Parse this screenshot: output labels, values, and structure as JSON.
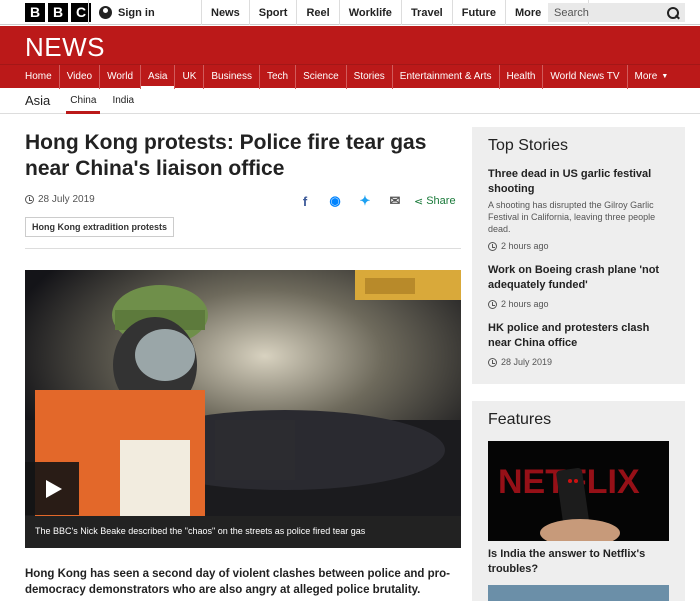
{
  "topbar": {
    "logo_letters": [
      "B",
      "B",
      "C"
    ],
    "signin": "Sign in",
    "nav": [
      "News",
      "Sport",
      "Reel",
      "Worklife",
      "Travel",
      "Future"
    ],
    "more": "More",
    "search_placeholder": "Search"
  },
  "banner": {
    "title": "NEWS"
  },
  "mainnav": [
    "Home",
    "Video",
    "World",
    "Asia",
    "UK",
    "Business",
    "Tech",
    "Science",
    "Stories",
    "Entertainment & Arts",
    "Health",
    "World News TV",
    "More"
  ],
  "subnav": {
    "section": "Asia",
    "items": [
      "China",
      "India"
    ]
  },
  "article": {
    "headline": "Hong Kong protests: Police fire tear gas near China's liaison office",
    "date": "28 July 2019",
    "share": "Share",
    "tag": "Hong Kong extradition protests",
    "caption": "The BBC's Nick Beake described the \"chaos\" on the streets as police fired tear gas",
    "intro": "Hong Kong has seen a second day of violent clashes between police and pro-democracy demonstrators who are also angry at alleged police brutality."
  },
  "top_stories": {
    "title": "Top Stories",
    "items": [
      {
        "title": "Three dead in US garlic festival shooting",
        "summary": "A shooting has disrupted the Gilroy Garlic Festival in California, leaving three people dead.",
        "time": "2 hours ago"
      },
      {
        "title": "Work on Boeing crash plane 'not adequately funded'",
        "summary": "",
        "time": "2 hours ago"
      },
      {
        "title": "HK police and protesters clash near China office",
        "summary": "",
        "time": "28 July 2019"
      }
    ]
  },
  "features": {
    "title": "Features",
    "image_text": "NETFLIX",
    "item_title": "Is India the answer to Netflix's troubles?"
  },
  "colors": {
    "brand_red": "#bb1919",
    "share_green": "#1a7a3a"
  }
}
